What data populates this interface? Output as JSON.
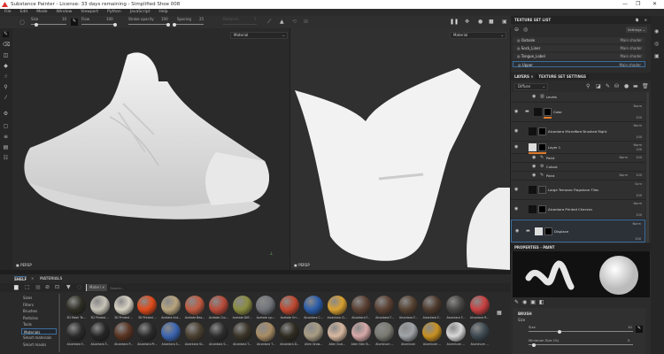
{
  "window": {
    "title": "Substance Painter - License: 33 days remaining - Simplified Shoe 008",
    "minimize": "—",
    "maximize": "❐",
    "close": "✕"
  },
  "menu": [
    "File",
    "Edit",
    "Mode",
    "Window",
    "Viewport",
    "Python",
    "JavaScript",
    "Help"
  ],
  "toolbar": {
    "size_label": "Size",
    "size_value": "10",
    "size_fraction": 0.15,
    "flow_label": "Flow",
    "flow_value": "100",
    "flow_fraction": 1.0,
    "stroke_opacity_label": "Stroke opacity",
    "stroke_opacity_value": "100",
    "stroke_opacity_fraction": 1.0,
    "spacing_label": "Spacing",
    "spacing_value": "25",
    "spacing_fraction": 0.05,
    "distance_label": "Distance",
    "distance_value": "1"
  },
  "viewport3d": {
    "channel": "Material",
    "label": "PERSP"
  },
  "viewport2d": {
    "channel": "Material",
    "label": "PERSP"
  },
  "texture_set_list": {
    "title": "TEXTURE SET LIST",
    "settings_label": "Settings",
    "items": [
      {
        "name": "Outsole",
        "shader": "Main shader"
      },
      {
        "name": "Sock_Liner",
        "shader": "Main shader"
      },
      {
        "name": "Tongue_Label",
        "shader": "Main shader"
      },
      {
        "name": "Upper",
        "shader": "Main shader",
        "selected": true
      }
    ]
  },
  "layers": {
    "tab_layers": "LAYERS",
    "tab_settings": "TEXTURE SET SETTINGS",
    "channel": "Diffuse",
    "items": [
      {
        "name": "Levels",
        "blend": "",
        "opacity": ""
      },
      {
        "name": "Color",
        "blend": "Norm",
        "opacity": "100"
      },
      {
        "name": "Alcantara Microfibre Brushed Right",
        "blend": "Norm",
        "opacity": "100"
      },
      {
        "name": "Layer 1",
        "blend": "Norm",
        "opacity": "100"
      },
      {
        "name": "Paint",
        "blend": "Norm",
        "opacity": "100"
      },
      {
        "name": "Cutout",
        "blend": "",
        "opacity": ""
      },
      {
        "name": "Paint",
        "blend": "Norm",
        "opacity": "100"
      },
      {
        "name": "Large Terrazzo Flagstone Tiles",
        "blend": "Scrn",
        "opacity": "100"
      },
      {
        "name": "Alcantara Printed Chevron",
        "blend": "Norm",
        "opacity": "100"
      },
      {
        "name": "Displace",
        "blend": "Norm",
        "opacity": "100"
      }
    ]
  },
  "properties": {
    "title": "PROPERTIES - PAINT",
    "section": "BRUSH",
    "group": "Size",
    "size_label": "Size",
    "size_value": "10",
    "size_fraction": 0.3,
    "min_size_label": "Minimum Size (%)",
    "min_size_value": "5",
    "min_size_fraction": 0.05
  },
  "shelf": {
    "tab_shelf": "SHELF",
    "tab_materials": "MATERIALS",
    "filter_tag": "Materi",
    "search_placeholder": "Search...",
    "categories": [
      "Sizes",
      "Filters",
      "Brushes",
      "Particles",
      "Tools",
      "Materials",
      "Smart materials",
      "Smart masks"
    ],
    "selected_category": "Materials",
    "materials": [
      {
        "name": "3D Mesh Te...",
        "color": "#2e2e24"
      },
      {
        "name": "3D Printed ...",
        "color": "#c8c3b8"
      },
      {
        "name": "3D Printed ...",
        "color": "#d8d2c4"
      },
      {
        "name": "3D Printed ...",
        "color": "#e04a1a"
      },
      {
        "name": "Acetate Ant...",
        "color": "#b8a47e"
      },
      {
        "name": "Acetate Bea...",
        "color": "#c05a40"
      },
      {
        "name": "Acetate Cro...",
        "color": "#b84a38"
      },
      {
        "name": "Acetate Diff...",
        "color": "#8a8c40"
      },
      {
        "name": "Acetate Lyc...",
        "color": "#70747a"
      },
      {
        "name": "Acetate Ori...",
        "color": "#c04830"
      },
      {
        "name": "Alcantara C...",
        "color": "#2a5ca8"
      },
      {
        "name": "Alcantara Cl...",
        "color": "#d8a030"
      },
      {
        "name": "Alcantara F...",
        "color": "#5a4032"
      },
      {
        "name": "Alcantara F...",
        "color": "#5a4032"
      },
      {
        "name": "Alcantara F...",
        "color": "#54402f"
      },
      {
        "name": "Alcantara F...",
        "color": "#4e3a2e"
      },
      {
        "name": "Alcantara F...",
        "color": "#464442"
      },
      {
        "name": "Alcantara R...",
        "color": "#c84040"
      },
      {
        "name": "Alcantara F...",
        "color": "#2a2a2a"
      },
      {
        "name": "Alcantara F...",
        "color": "#262626"
      },
      {
        "name": "Alcantara P...",
        "color": "#5a3422"
      },
      {
        "name": "Alcantara Pr...",
        "color": "#2a2a2a"
      },
      {
        "name": "Alcantara S...",
        "color": "#3a64b0"
      },
      {
        "name": "Alcantara St...",
        "color": "#4a4030"
      },
      {
        "name": "Alcantara S...",
        "color": "#2c2c2c"
      },
      {
        "name": "Alcantara T...",
        "color": "#3a3428"
      },
      {
        "name": "Alcantara T...",
        "color": "#a88c64"
      },
      {
        "name": "Alcantara D...",
        "color": "#302c22"
      },
      {
        "name": "Alien Grow...",
        "color": "#a89c84"
      },
      {
        "name": "Alien Scal...",
        "color": "#d8b8a0"
      },
      {
        "name": "Alien Skin B...",
        "color": "#d8a8a8"
      },
      {
        "name": "Aluminum ...",
        "color": "#7a7a72"
      },
      {
        "name": "Aluminum",
        "color": "#a0a4a8"
      },
      {
        "name": "Aluminum ...",
        "color": "#c89020"
      },
      {
        "name": "Aluminum ...",
        "color": "#d8d8d8"
      },
      {
        "name": "Aluminum ...",
        "color": "#3c4850"
      }
    ]
  },
  "colors": {
    "accent": "#e07a2a",
    "selection": "#3c6e9c"
  }
}
